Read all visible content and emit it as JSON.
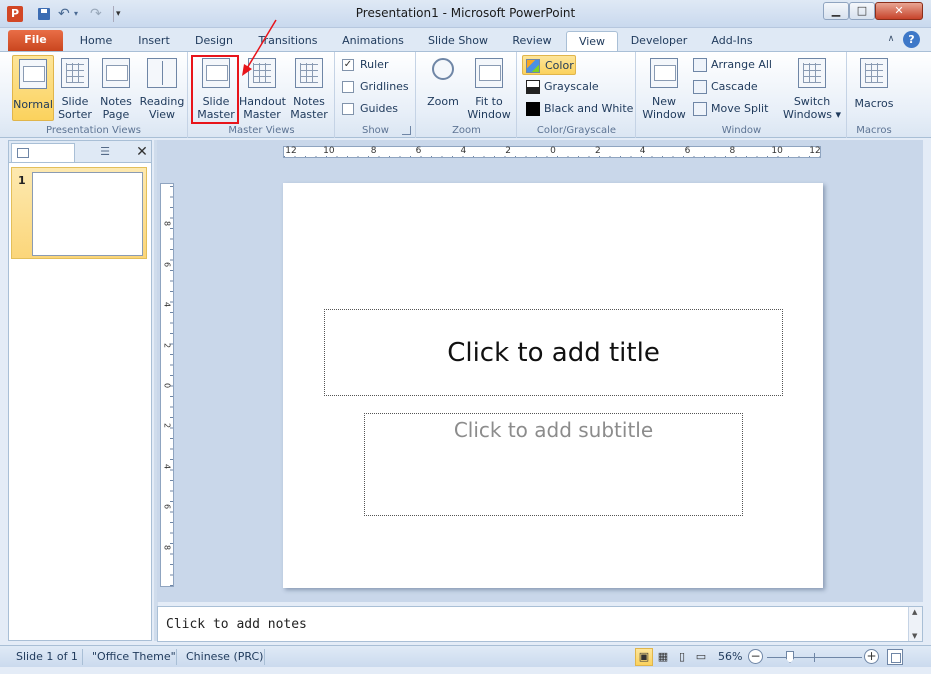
{
  "window": {
    "title": "Presentation1 - Microsoft PowerPoint",
    "minimize": "▁",
    "maximize": "□",
    "close": "✕"
  },
  "app_icon_letter": "P",
  "qat": {
    "undo": "↶",
    "redo": "↷",
    "customize": "▾"
  },
  "tabs": {
    "file": "File",
    "home": "Home",
    "insert": "Insert",
    "design": "Design",
    "transitions": "Transitions",
    "animations": "Animations",
    "slide_show": "Slide Show",
    "review": "Review",
    "view": "View",
    "developer": "Developer",
    "add_ins": "Add-Ins"
  },
  "ribbon_minimize": "∧",
  "help": "?",
  "ribbon": {
    "presentation_views": {
      "label": "Presentation Views",
      "normal": "Normal",
      "slide_sorter": "Slide Sorter",
      "notes_page": "Notes Page",
      "reading_view": "Reading View"
    },
    "master_views": {
      "label": "Master Views",
      "slide_master": "Slide Master",
      "handout_master": "Handout Master",
      "notes_master": "Notes Master"
    },
    "show": {
      "label": "Show",
      "ruler": "Ruler",
      "ruler_checked": "✓",
      "gridlines": "Gridlines",
      "guides": "Guides"
    },
    "zoom": {
      "label": "Zoom",
      "zoom": "Zoom",
      "fit_to_window": "Fit to Window"
    },
    "color_grayscale": {
      "label": "Color/Grayscale",
      "color": "Color",
      "grayscale": "Grayscale",
      "black_and_white": "Black and White"
    },
    "window": {
      "label": "Window",
      "new_window": "New Window",
      "arrange_all": "Arrange All",
      "cascade": "Cascade",
      "move_split": "Move Split",
      "switch_windows": "Switch Windows ▾"
    },
    "macros": {
      "label": "Macros",
      "macros": "Macros"
    }
  },
  "slides_panel": {
    "outline_tab": "☰",
    "close": "✕",
    "thumbnail_number": "1"
  },
  "ruler": {
    "h_labels": [
      "12",
      "10",
      "8",
      "6",
      "4",
      "2",
      "0",
      "2",
      "4",
      "6",
      "8",
      "10",
      "12"
    ],
    "v_labels": [
      "8",
      "6",
      "4",
      "2",
      "0",
      "2",
      "4",
      "6",
      "8"
    ]
  },
  "slide": {
    "title_placeholder": "Click to add title",
    "subtitle_placeholder": "Click to add subtitle"
  },
  "notes": {
    "placeholder": "Click to add notes"
  },
  "status": {
    "slide_info": "Slide 1 of 1",
    "theme": "\"Office Theme\"",
    "language": "Chinese (PRC)",
    "zoom_level": "56%",
    "zoom_minus": "−",
    "zoom_plus": "+"
  },
  "colors": {
    "accent_file_tab": "#d24726",
    "annotation_red": "#e8141a",
    "selected_gold": "#fbd25d"
  }
}
